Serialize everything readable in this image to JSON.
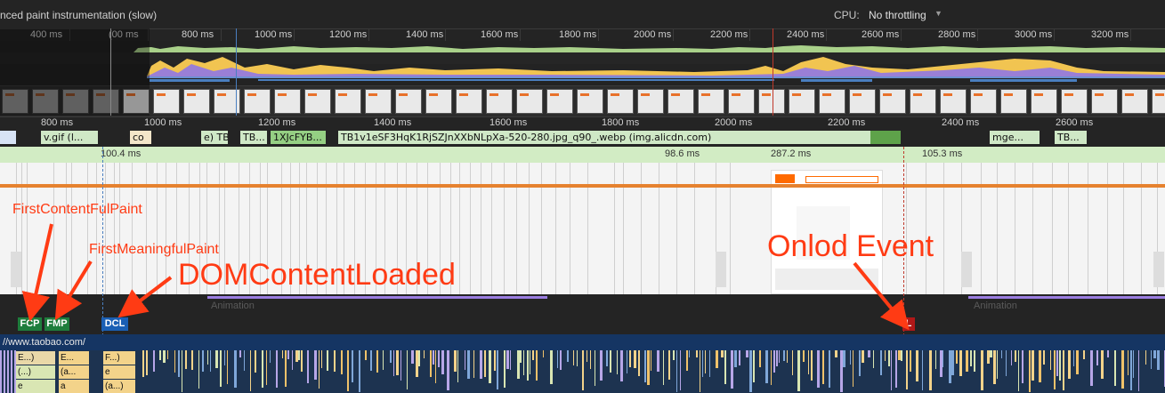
{
  "topbar": {
    "title": "nced paint instrumentation (slow)",
    "cpu_label": "CPU:",
    "cpu_value": "No throttling"
  },
  "overview_ruler": [
    "400 ms",
    "600 ms",
    "800 ms",
    "1000 ms",
    "1200 ms",
    "1400 ms",
    "1600 ms",
    "1800 ms",
    "2000 ms",
    "2200 ms",
    "2400 ms",
    "2600 ms",
    "2800 ms",
    "3000 ms",
    "3200 ms"
  ],
  "overview_ruler_shown": [
    "400 ms",
    "(00 ms",
    "800 ms",
    "1000 ms",
    "1200 ms",
    "1400 ms",
    "1600 ms",
    "1800 ms",
    "2000 ms",
    "2200 ms",
    "2400 ms",
    "2600 ms",
    "2800 ms",
    "3000 ms",
    "3200 ms"
  ],
  "detail_ruler": [
    "800 ms",
    "1000 ms",
    "1200 ms",
    "1400 ms",
    "1600 ms",
    "1800 ms",
    "2000 ms",
    "2200 ms",
    "2400 ms",
    "2600 ms"
  ],
  "network_requests": [
    {
      "label": "v.gif (l..."
    },
    {
      "label": "co"
    },
    {
      "label": "e) TB"
    },
    {
      "label": "TB..."
    },
    {
      "label": "1XJcFYB..."
    },
    {
      "label": "TB1v1eSF3HqK1RjSZJnXXbNLpXa-520-280.jpg_q90_.webp (img.alicdn.com)"
    },
    {
      "label": "mge..."
    },
    {
      "label": "TB..."
    }
  ],
  "frame_durations": [
    "100.4 ms",
    "98.6 ms",
    "287.2 ms",
    "105.3 ms"
  ],
  "animation_labels": [
    "Animation",
    "Animation"
  ],
  "timing_markers": [
    {
      "label": "FCP",
      "color": "#1e7d3c"
    },
    {
      "label": "FMP",
      "color": "#1e7d3c"
    },
    {
      "label": "DCL",
      "color": "#1a5fb4"
    },
    {
      "label": "L",
      "color": "#b01818"
    }
  ],
  "main_thread_url": "//www.taobao.com/",
  "flame_labels": [
    "E...)",
    "(...)",
    "e",
    "E...",
    "(a...",
    "a",
    "F...)",
    "e",
    "(a...)"
  ],
  "annotations": {
    "fcp": "FirstContentFulPaint",
    "fmp": "FirstMeaningfulPaint",
    "dcl": "DOMContentLoaded",
    "onload": "Onlod Event"
  },
  "colors": {
    "annotation": "#ff3b14",
    "fcp": "#1e7d3c",
    "dcl": "#1a5fb4",
    "load": "#b01818"
  }
}
